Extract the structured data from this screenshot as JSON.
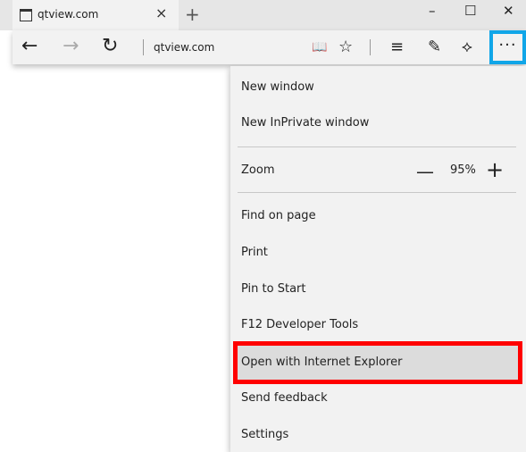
{
  "tab": {
    "title": "qtview.com",
    "close_glyph": "×",
    "new_tab_glyph": "+"
  },
  "window_controls": {
    "minimize": "–",
    "maximize": "☐",
    "close": "✕"
  },
  "nav": {
    "back": "←",
    "forward": "→",
    "refresh": "↻",
    "address": "qtview.com"
  },
  "tools": {
    "reading_view": "📖",
    "favorite": "☆",
    "hub": "≡",
    "web_note": "✎",
    "share": "⟡",
    "more": "···"
  },
  "menu": {
    "items": [
      "New window",
      "New InPrivate window",
      "Zoom",
      "Find on page",
      "Print",
      "Pin to Start",
      "F12 Developer Tools",
      "Open with Internet Explorer",
      "Send feedback",
      "Settings"
    ],
    "zoom": {
      "minus": "—",
      "value": "95%",
      "plus": "+"
    }
  },
  "colors": {
    "more_outline": "#11a6e8",
    "highlight_outline": "#ff0000",
    "menu_bg": "#f2f2f2"
  }
}
